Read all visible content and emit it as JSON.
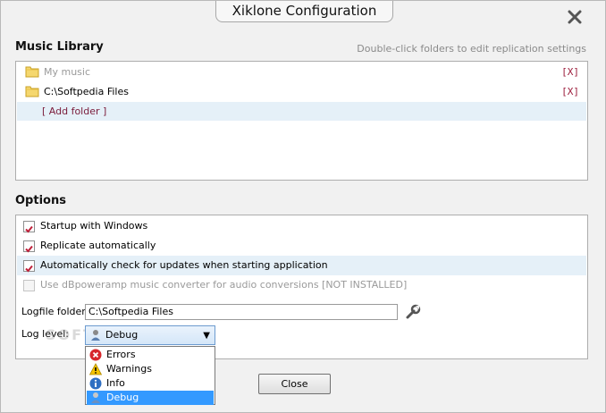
{
  "window": {
    "title": "Xiklone Configuration"
  },
  "music_library": {
    "title": "Music Library",
    "hint": "Double-click folders to edit replication settings",
    "folders": [
      {
        "name": "My music",
        "remove": "[X]",
        "dimmed": true
      },
      {
        "name": "C:\\Softpedia Files",
        "remove": "[X]",
        "dimmed": false
      }
    ],
    "add_folder": "[ Add folder ]"
  },
  "options": {
    "title": "Options",
    "checkboxes": [
      {
        "label": "Startup with Windows",
        "checked": true,
        "enabled": true
      },
      {
        "label": "Replicate automatically",
        "checked": true,
        "enabled": true
      },
      {
        "label": "Automatically check for updates when starting application",
        "checked": true,
        "enabled": true
      },
      {
        "label": "Use dBpoweramp music converter for audio conversions [NOT INSTALLED]",
        "checked": false,
        "enabled": false
      }
    ],
    "logfile_label": "Logfile folder:",
    "logfile_value": "C:\\Softpedia Files",
    "loglevel_label": "Log level:",
    "loglevel_selected": "Debug",
    "loglevel_options": [
      "Errors",
      "Warnings",
      "Info",
      "Debug"
    ]
  },
  "watermark": "SOFTPEDIA",
  "close_button": "Close",
  "colors": {
    "remove_link": "#9b1b3a",
    "highlight_row": "#e5f0f8",
    "selected_item": "#3399ff"
  }
}
